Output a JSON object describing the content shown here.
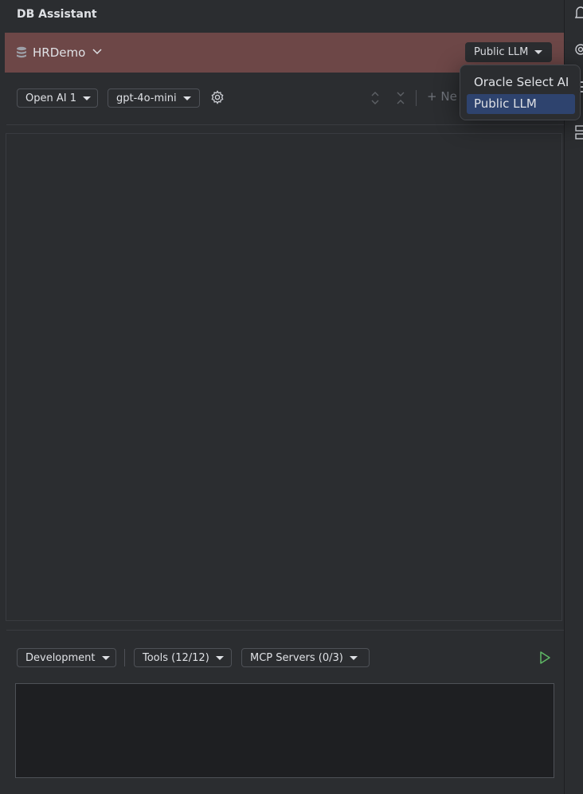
{
  "panel": {
    "title": "DB Assistant"
  },
  "connection": {
    "name": "HRDemo",
    "llm_mode": "Public LLM"
  },
  "llm_menu": {
    "items": [
      "Oracle Select AI",
      "Public LLM"
    ],
    "selected_index": 1
  },
  "toolbar": {
    "provider": "Open AI 1",
    "model": "gpt-4o-mini",
    "new_label": "Ne"
  },
  "bottom": {
    "profile": "Development",
    "tools": "Tools (12/12)",
    "mcp": "MCP Servers (0/3)",
    "prompt_value": ""
  },
  "colors": {
    "banner": "#6d4747",
    "selected": "#2e436e",
    "run": "#5fb865"
  }
}
